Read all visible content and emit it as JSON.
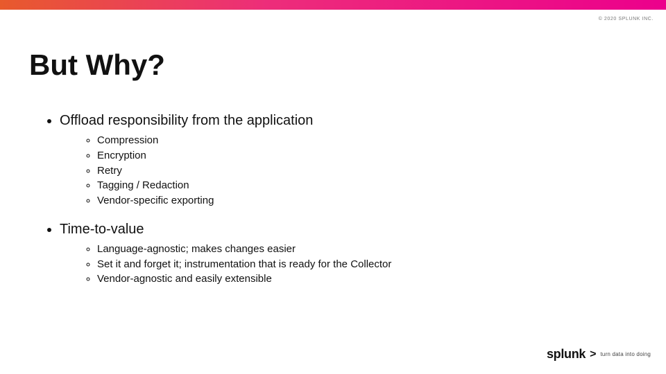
{
  "copyright": "© 2020 SPLUNK INC.",
  "title": "But Why?",
  "bullets": [
    {
      "text": "Offload responsibility from the application",
      "sub": [
        "Compression",
        "Encryption",
        "Retry",
        "Tagging / Redaction",
        "Vendor-specific exporting"
      ]
    },
    {
      "text": "Time-to-value",
      "sub": [
        "Language-agnostic; makes changes easier",
        "Set it and forget it; instrumentation that is ready for the Collector",
        "Vendor-agnostic and easily extensible"
      ]
    }
  ],
  "logo": {
    "brand": "splunk",
    "arrow": ">",
    "tagline": "turn data into doing"
  }
}
